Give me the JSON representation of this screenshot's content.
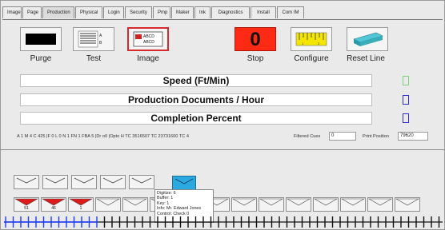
{
  "tabs": [
    "Image",
    "Page",
    "Production",
    "Physical",
    "Login",
    "Security",
    "Pmp",
    "Maker",
    "Ink",
    "Diagnostics",
    "Install",
    "Com IM"
  ],
  "active_tab": "Production",
  "toolbar": {
    "purge_label": "Purge",
    "test_label": "Test",
    "image_label": "Image",
    "image_icon_text": "ABCD ABCD",
    "stop_label": "Stop",
    "stop_value": "0",
    "configure_label": "Configure",
    "reset_label": "Reset Line"
  },
  "panels": {
    "speed": "Speed (Ft/Min)",
    "production": "Production Documents / Hour",
    "completion": "Completion Percent"
  },
  "status_text": "A 1 M 4 C 425 |F 0 L 0 N 1 FN 1 FBA 5 |Dr o0 |Opto H TC 3516507 TC 23731600 TC 4",
  "filtered_cues_label": "Filtered Cues",
  "filtered_cues_value": "0",
  "print_position_label": "Print Position",
  "print_position_value": "79620",
  "cards_bottom": [
    "51",
    "46",
    "1",
    "",
    "",
    "",
    "",
    "",
    "",
    "",
    "",
    "",
    "",
    "",
    "",
    ""
  ],
  "tooltip": {
    "digitize": "Digitize: 6",
    "buffer": "Buffer: 1",
    "key": "Key: 1",
    "info": "Info: Mr. Edward Jones",
    "control": "Control: Check 0"
  },
  "colors": {
    "stop_red": "#ff2a14",
    "card_red": "#e01a1a",
    "highlight_blue": "#2aa8e0",
    "ruler_blue": "#1e3cff",
    "ind_green": "#7ad27a",
    "ind_blue": "#2d2dd6"
  }
}
